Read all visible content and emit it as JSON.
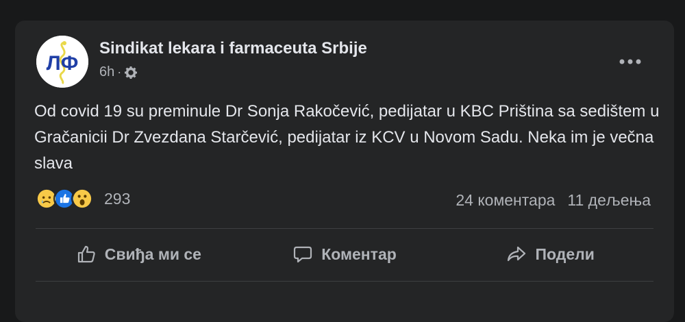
{
  "post": {
    "author": "Sindikat lekara i farmaceuta Srbije",
    "avatar_text": "ЛФ",
    "time": "6h",
    "separator": "·",
    "privacy_icon": "gear-icon",
    "text": "Od covid 19 su preminule Dr Sonja Rakočević, pedijatar u KBC Priština sa sedištem u Gračanicii Dr Zvezdana Starčević, pedijatar iz KCV u Novom Sadu. Neka im je večna slava"
  },
  "reactions": {
    "icons": [
      "sad-emoji-icon",
      "like-emoji-icon",
      "wow-emoji-icon"
    ],
    "count": "293"
  },
  "stats": {
    "comments": "24 коментара",
    "shares": "11 дељења"
  },
  "actions": {
    "like": "Свиђа ми се",
    "comment": "Коментар",
    "share": "Подели"
  },
  "colors": {
    "background": "#18191a",
    "card": "#242526",
    "text": "#e4e6eb",
    "secondary": "#b0b3b8",
    "like_blue": "#1b74e4"
  }
}
